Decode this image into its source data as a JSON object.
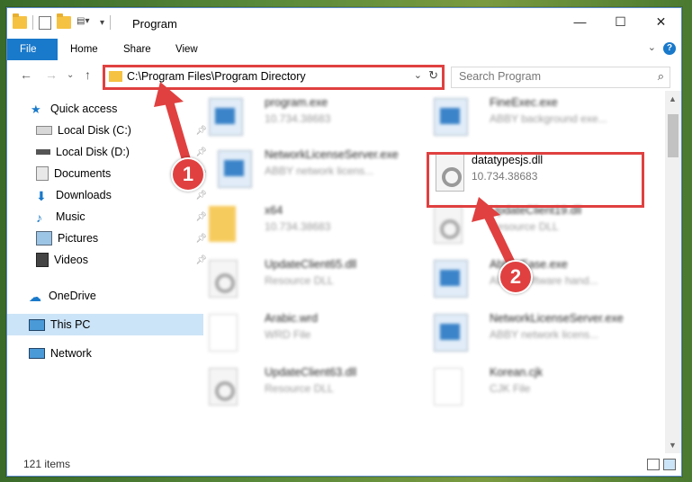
{
  "window": {
    "title": "Program",
    "controls": [
      "—",
      "☐",
      "✕"
    ]
  },
  "ribbon": {
    "tabs": [
      "File",
      "Home",
      "Share",
      "View"
    ]
  },
  "address": {
    "path": "C:\\Program Files\\Program Directory",
    "search_placeholder": "Search Program"
  },
  "nav": {
    "quick_access": "Quick access",
    "items": [
      "Local Disk (C:)",
      "Local Disk (D:)",
      "Documents",
      "Downloads",
      "Music",
      "Pictures",
      "Videos"
    ],
    "onedrive": "OneDrive",
    "thispc": "This PC",
    "network": "Network"
  },
  "files": [
    {
      "name": "program.exe",
      "sub": "10.734.38683",
      "type": "exe"
    },
    {
      "name": "FineExec.exe",
      "sub": "ABBY background exe...",
      "type": "exe"
    },
    {
      "name": "NetworkLicenseServer.exe",
      "sub": "ABBY network licens...",
      "type": "exe"
    },
    {
      "name": "datatypesjs.dll",
      "sub": "10.734.38683",
      "type": "dll"
    },
    {
      "name": "x64",
      "sub": "10.734.38683",
      "type": "folder"
    },
    {
      "name": "UpdateClient19.dll",
      "sub": "Resource DLL",
      "type": "dll"
    },
    {
      "name": "UpdateClient65.dll",
      "sub": "Resource DLL",
      "type": "dll"
    },
    {
      "name": "AbbyyEase.exe",
      "sub": "ABBY software hand...",
      "type": "exe"
    },
    {
      "name": "Arabic.wrd",
      "sub": "WRD File",
      "type": "doc"
    },
    {
      "name": "NetworkLicenseServer.exe",
      "sub": "ABBY network licens...",
      "type": "exe"
    },
    {
      "name": "UpdateClient63.dll",
      "sub": "Resource DLL",
      "type": "dll"
    },
    {
      "name": "Korean.cjk",
      "sub": "CJK File",
      "type": "doc"
    }
  ],
  "status": {
    "count": "121 items"
  },
  "annotations": {
    "badge1": "1",
    "badge2": "2"
  },
  "colors": {
    "accent": "#1979ca",
    "highlight": "#e04040"
  }
}
